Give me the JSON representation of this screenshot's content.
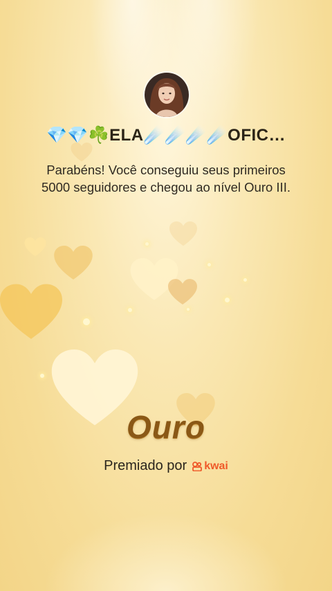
{
  "profile": {
    "name": "💎💎☘️ELA☄️☄️☄️☄️OFIC…",
    "avatar_icon": "profile-photo"
  },
  "message": "Parabéns! Você conseguiu seus primeiros 5000 seguidores e chegou ao nível Ouro III.",
  "level": "Ouro",
  "awarded_by": {
    "label": "Premiado por",
    "brand_name": "kwai",
    "brand_icon": "kwai-logo-icon",
    "brand_color": "#ef5a2a"
  },
  "theme": {
    "gold_text": "#8a5816",
    "background": "#f6dc96"
  }
}
